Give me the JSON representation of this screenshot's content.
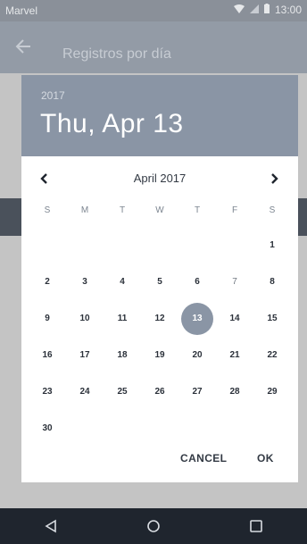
{
  "status_bar": {
    "carrier": "Marvel",
    "clock": "13:00",
    "icons": [
      "wifi-icon",
      "signal-icon",
      "battery-icon"
    ]
  },
  "app_bar": {
    "title": "Registros por día",
    "back_icon": "arrow-back-icon"
  },
  "dialog": {
    "year": "2017",
    "date_title": "Thu, Apr 13",
    "month_label": "April 2017",
    "weekdays": [
      "S",
      "M",
      "T",
      "W",
      "T",
      "F",
      "S"
    ],
    "days": [
      "1",
      "2",
      "3",
      "4",
      "5",
      "6",
      "7",
      "8",
      "9",
      "10",
      "11",
      "12",
      "13",
      "14",
      "15",
      "16",
      "17",
      "18",
      "19",
      "20",
      "21",
      "22",
      "23",
      "24",
      "25",
      "26",
      "27",
      "28",
      "29",
      "30"
    ],
    "selected_day": "13",
    "cancel_label": "CANCEL",
    "ok_label": "OK"
  },
  "nav_bar": {
    "icons": [
      "back-triangle-icon",
      "home-circle-icon",
      "recents-square-icon"
    ]
  },
  "colors": {
    "header": "#8a95a5",
    "selected": "#8a95a5",
    "nav_bar": "#1f252e"
  }
}
